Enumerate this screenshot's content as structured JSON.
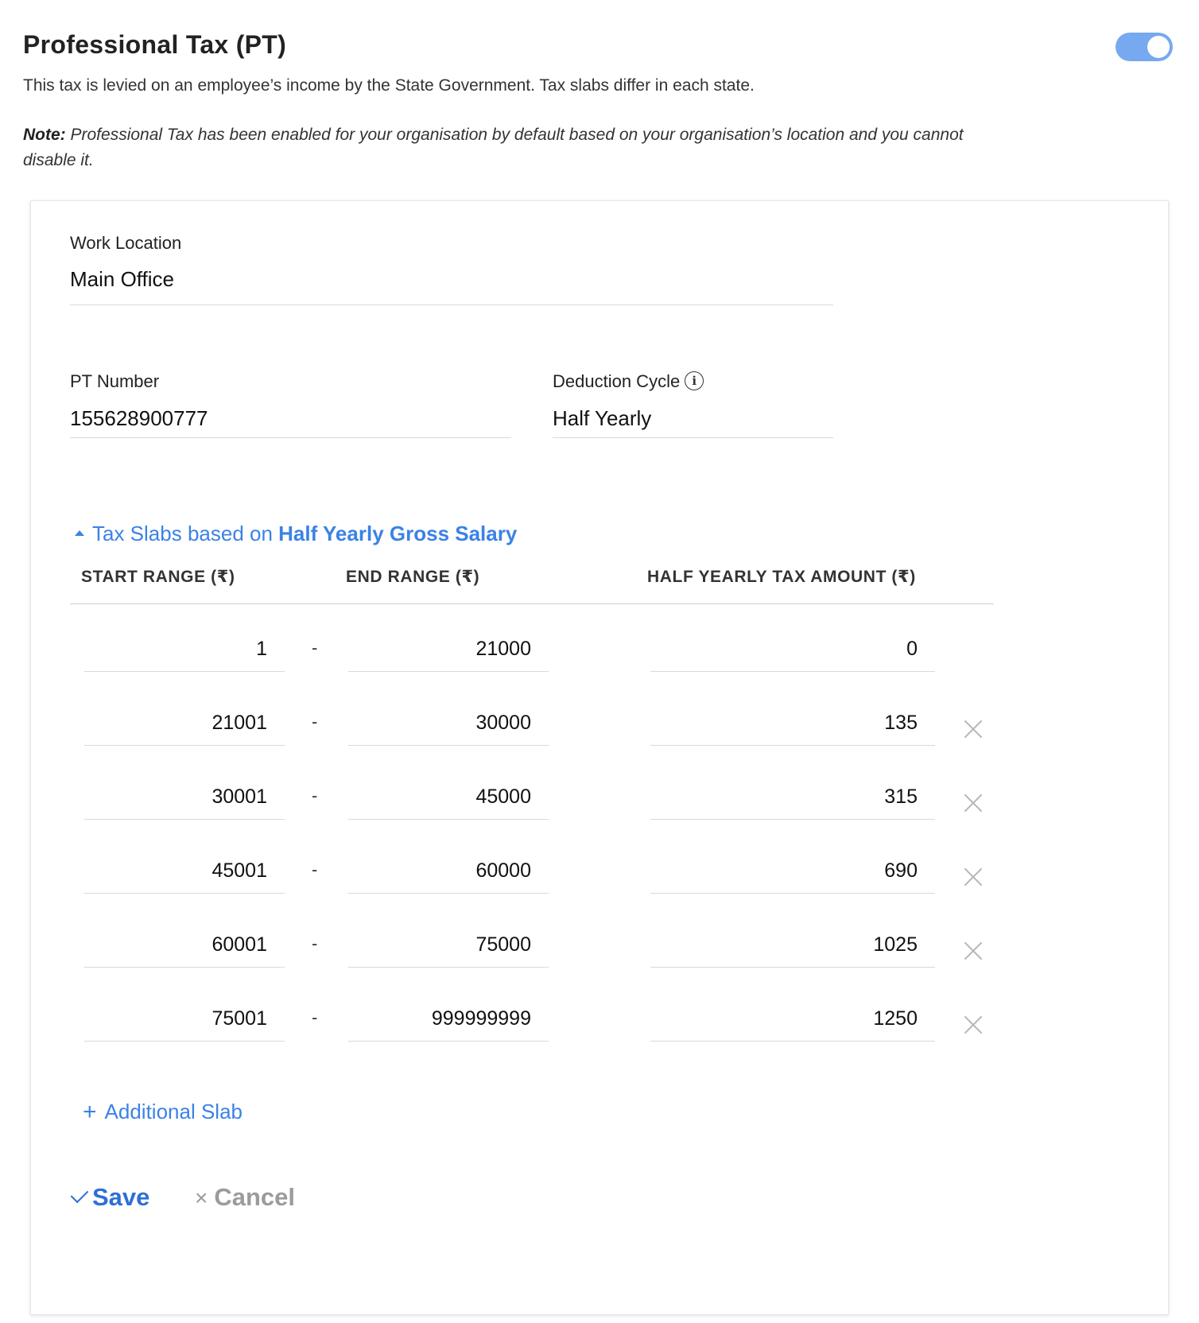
{
  "header": {
    "title": "Professional Tax (PT)",
    "subtitle": "This tax is levied on an employee’s income by the State Government. Tax slabs differ in each state.",
    "note_label": "Note:",
    "note_text": " Professional Tax has been enabled for your organisation by default based on your organisation’s location and you cannot disable it.",
    "toggle_on": true
  },
  "form": {
    "work_location_label": "Work Location",
    "work_location_value": "Main Office",
    "pt_number_label": "PT Number",
    "pt_number_value": "155628900777",
    "deduction_cycle_label": "Deduction Cycle",
    "deduction_cycle_value": "Half Yearly",
    "info_icon_glyph": "i"
  },
  "slabs": {
    "toggle_prefix": "Tax Slabs based on ",
    "toggle_emphasis": "Half Yearly Gross Salary",
    "columns": {
      "start": "START RANGE (₹)",
      "end": "END RANGE (₹)",
      "amount": "HALF YEARLY TAX AMOUNT (₹)"
    },
    "separator": "-",
    "rows": [
      {
        "start": "1",
        "end": "21000",
        "amount": "0",
        "removable": false
      },
      {
        "start": "21001",
        "end": "30000",
        "amount": "135",
        "removable": true
      },
      {
        "start": "30001",
        "end": "45000",
        "amount": "315",
        "removable": true
      },
      {
        "start": "45001",
        "end": "60000",
        "amount": "690",
        "removable": true
      },
      {
        "start": "60001",
        "end": "75000",
        "amount": "1025",
        "removable": true
      },
      {
        "start": "75001",
        "end": "999999999",
        "amount": "1250",
        "removable": true
      }
    ],
    "add_label": "Additional Slab",
    "add_icon": "+"
  },
  "actions": {
    "save_label": "Save",
    "cancel_label": "Cancel",
    "cancel_icon": "×"
  },
  "colors": {
    "accent": "#3b82e6",
    "toggle": "#76a9ef",
    "muted": "#9b9b9b"
  }
}
